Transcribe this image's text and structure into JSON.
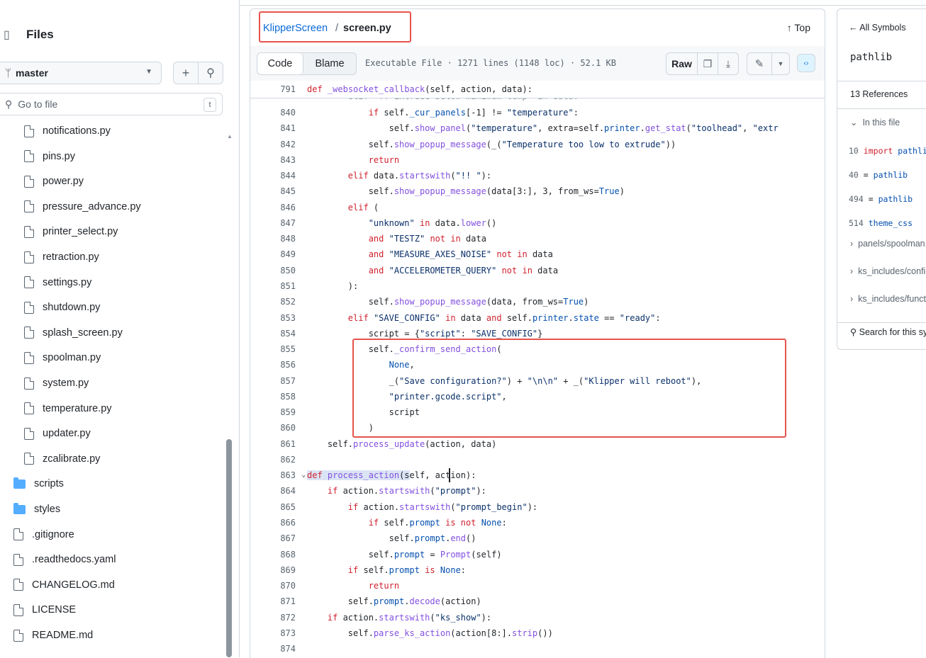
{
  "sidebar": {
    "title": "Files",
    "branch": "master",
    "search_placeholder": "Go to file",
    "shortcut": "t",
    "items": [
      {
        "type": "file",
        "name": "notifications.py"
      },
      {
        "type": "file",
        "name": "pins.py"
      },
      {
        "type": "file",
        "name": "power.py"
      },
      {
        "type": "file",
        "name": "pressure_advance.py"
      },
      {
        "type": "file",
        "name": "printer_select.py"
      },
      {
        "type": "file",
        "name": "retraction.py"
      },
      {
        "type": "file",
        "name": "settings.py"
      },
      {
        "type": "file",
        "name": "shutdown.py"
      },
      {
        "type": "file",
        "name": "splash_screen.py"
      },
      {
        "type": "file",
        "name": "spoolman.py"
      },
      {
        "type": "file",
        "name": "system.py"
      },
      {
        "type": "file",
        "name": "temperature.py"
      },
      {
        "type": "file",
        "name": "updater.py"
      },
      {
        "type": "file",
        "name": "zcalibrate.py"
      },
      {
        "type": "dir",
        "name": "scripts"
      },
      {
        "type": "dir",
        "name": "styles"
      },
      {
        "type": "file",
        "name": ".gitignore"
      },
      {
        "type": "file",
        "name": ".readthedocs.yaml"
      },
      {
        "type": "file",
        "name": "CHANGELOG.md"
      },
      {
        "type": "file",
        "name": "LICENSE"
      },
      {
        "type": "file",
        "name": "README.md"
      }
    ]
  },
  "header": {
    "repo": "KlipperScreen",
    "separator": "/",
    "file": "screen.py",
    "top_label": "↑ Top"
  },
  "toolbar": {
    "code_label": "Code",
    "blame_label": "Blame",
    "meta": "Executable File · 1271 lines (1148 loc) · 52.1 KB",
    "raw_label": "Raw"
  },
  "sticky": {
    "num": "791",
    "text": "def _websocket_callback(self, action, data):"
  },
  "cut_line": "elif \"!! Extrude below minimum temp\" in data:",
  "lines": [
    {
      "n": "840",
      "html": "            <span class='kw'>if</span> self.<span class='pr'>_cur_panels</span>[-1] != <span class='st'>\"temperature\"</span>:"
    },
    {
      "n": "841",
      "html": "                self.<span class='fn'>show_panel</span>(<span class='st'>\"temperature\"</span>, extra=self.<span class='pr'>printer</span>.<span class='fn'>get_stat</span>(<span class='st'>\"toolhead\"</span>, <span class='st'>\"extr</span>"
    },
    {
      "n": "842",
      "html": "            self.<span class='fn'>show_popup_message</span>(_(<span class='st'>\"Temperature too low to extrude\"</span>))"
    },
    {
      "n": "843",
      "html": "            <span class='kw'>return</span>"
    },
    {
      "n": "844",
      "html": "        <span class='kw'>elif</span> data.<span class='fn'>startswith</span>(<span class='st'>\"!! \"</span>):"
    },
    {
      "n": "845",
      "html": "            self.<span class='fn'>show_popup_message</span>(data[3:], 3, from_ws=<span class='pr'>True</span>)"
    },
    {
      "n": "846",
      "html": "        <span class='kw'>elif</span> ("
    },
    {
      "n": "847",
      "html": "            <span class='st'>\"unknown\"</span> <span class='kw'>in</span> data.<span class='fn'>lower</span>()"
    },
    {
      "n": "848",
      "html": "            <span class='kw'>and</span> <span class='st'>\"TESTZ\"</span> <span class='kw'>not in</span> data"
    },
    {
      "n": "849",
      "html": "            <span class='kw'>and</span> <span class='st'>\"MEASURE_AXES_NOISE\"</span> <span class='kw'>not in</span> data"
    },
    {
      "n": "850",
      "html": "            <span class='kw'>and</span> <span class='st'>\"ACCELEROMETER_QUERY\"</span> <span class='kw'>not in</span> data"
    },
    {
      "n": "851",
      "html": "        ):"
    },
    {
      "n": "852",
      "html": "            self.<span class='fn'>show_popup_message</span>(data, from_ws=<span class='pr'>True</span>)"
    },
    {
      "n": "853",
      "html": "        <span class='kw'>elif</span> <span class='st'>\"SAVE_CONFIG\"</span> <span class='kw'>in</span> data <span class='kw'>and</span> self.<span class='pr'>printer</span>.<span class='pr'>state</span> == <span class='st'>\"ready\"</span>:"
    },
    {
      "n": "854",
      "html": "            script = {<span class='st'>\"script\"</span>: <span class='st'>\"SAVE_CONFIG\"</span>}"
    },
    {
      "n": "855",
      "html": "            self.<span class='fn'>_confirm_send_action</span>("
    },
    {
      "n": "856",
      "html": "                <span class='pr'>None</span>,"
    },
    {
      "n": "857",
      "html": "                _(<span class='st'>\"Save configuration?\"</span>) + <span class='st'>\"\\n\\n\"</span> + _(<span class='st'>\"Klipper will reboot\"</span>),"
    },
    {
      "n": "858",
      "html": "                <span class='st'>\"printer.gcode.script\"</span>,"
    },
    {
      "n": "859",
      "html": "                script"
    },
    {
      "n": "860",
      "html": "            )"
    },
    {
      "n": "861",
      "html": "    self.<span class='fn'>process_update</span>(action, data)"
    },
    {
      "n": "862",
      "html": ""
    },
    {
      "n": "863",
      "html": "<span class='hl'><span class='kw'>def</span> <span class='fn'>process_action</span>(s</span>elf, action):",
      "fold": true
    },
    {
      "n": "864",
      "html": "    <span class='kw'>if</span> action.<span class='fn'>startswith</span>(<span class='st'>\"prompt\"</span>):"
    },
    {
      "n": "865",
      "html": "        <span class='kw'>if</span> action.<span class='fn'>startswith</span>(<span class='st'>\"prompt_begin\"</span>):"
    },
    {
      "n": "866",
      "html": "            <span class='kw'>if</span> self.<span class='pr'>prompt</span> <span class='kw'>is not</span> <span class='pr'>None</span>:"
    },
    {
      "n": "867",
      "html": "                self.<span class='pr'>prompt</span>.<span class='fn'>end</span>()"
    },
    {
      "n": "868",
      "html": "            self.<span class='pr'>prompt</span> = <span class='fn'>Prompt</span>(self)"
    },
    {
      "n": "869",
      "html": "        <span class='kw'>if</span> self.<span class='pr'>prompt</span> <span class='kw'>is</span> <span class='pr'>None</span>:"
    },
    {
      "n": "870",
      "html": "            <span class='kw'>return</span>"
    },
    {
      "n": "871",
      "html": "        self.<span class='pr'>prompt</span>.<span class='fn'>decode</span>(action)"
    },
    {
      "n": "872",
      "html": "    <span class='kw'>if</span> action.<span class='fn'>startswith</span>(<span class='st'>\"ks_show\"</span>):"
    },
    {
      "n": "873",
      "html": "        self.<span class='fn'>parse_ks_action</span>(action[8:].<span class='fn'>strip</span>())"
    },
    {
      "n": "874",
      "html": ""
    }
  ],
  "symbols": {
    "back": "← All Symbols",
    "name": "pathlib",
    "refs": "13 References",
    "in_file": "In this file",
    "refs_list": [
      {
        "n": "10",
        "html": "<span class='kw'>import</span> <span class='pr'>pathlib</span>"
      },
      {
        "n": "40",
        "html": "= <span class='pr'>pathlib</span>"
      },
      {
        "n": "494",
        "html": "= <span class='pr'>pathlib</span>"
      },
      {
        "n": "514",
        "html": "<span class='pr'>theme_css</span>"
      }
    ],
    "groups": [
      "panels/spoolman.py",
      "ks_includes/config.py",
      "ks_includes/functions.py"
    ],
    "search_label": "Search for this symbol"
  }
}
